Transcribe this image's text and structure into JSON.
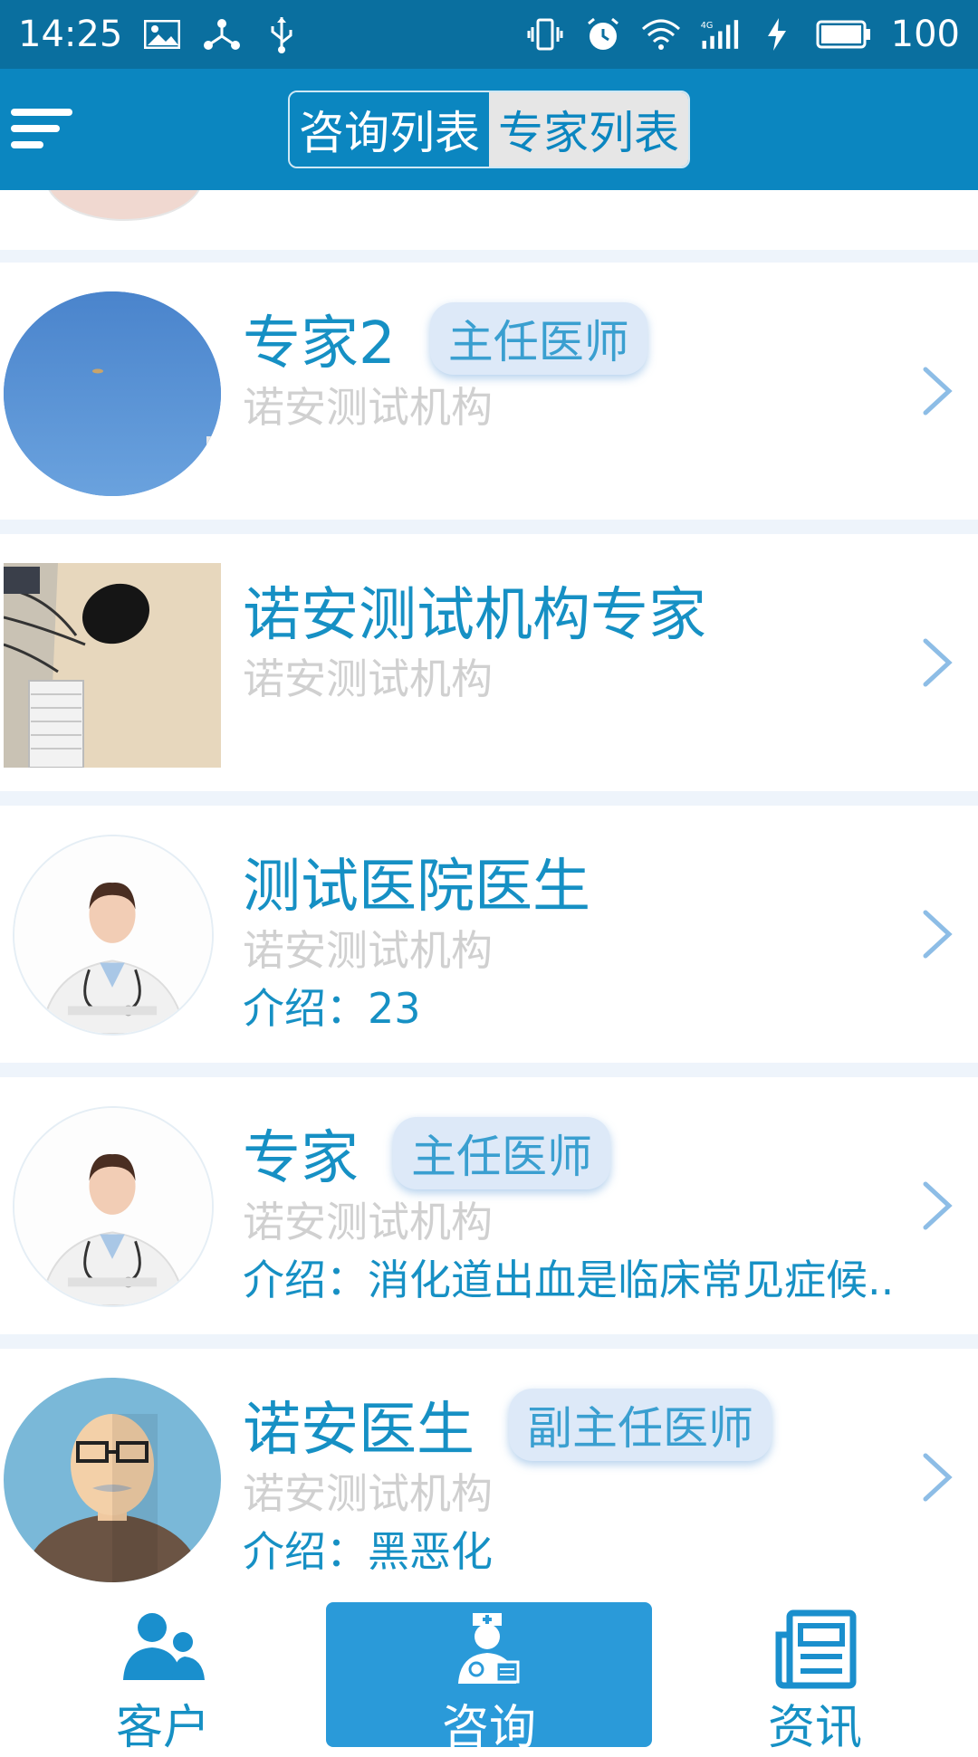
{
  "status_bar": {
    "time": "14:25",
    "battery": "100",
    "icons": [
      "image-icon",
      "share-icon",
      "usb-icon",
      "vibrate-icon",
      "alarm-icon",
      "wifi-icon",
      "signal-4g-icon",
      "charging-icon",
      "battery-icon"
    ]
  },
  "header": {
    "menu_icon": "menu-icon",
    "tabs": [
      {
        "label": "咨询列表",
        "active": true
      },
      {
        "label": "专家列表",
        "active": false
      }
    ]
  },
  "experts": [
    {
      "name": "专家2",
      "title": "主任医师",
      "org": "诺安测试机构",
      "intro": "",
      "avatar": "sky-photo"
    },
    {
      "name": "诺安测试机构专家",
      "title": "",
      "org": "诺安测试机构",
      "intro": "",
      "avatar": "desk-photo"
    },
    {
      "name": "测试医院医生",
      "title": "",
      "org": "诺安测试机构",
      "intro": "介绍：23",
      "avatar": "female-doctor"
    },
    {
      "name": "专家",
      "title": "主任医师",
      "org": "诺安测试机构",
      "intro": "介绍：消化道出血是临床常见症候..",
      "avatar": "female-doctor"
    },
    {
      "name": "诺安医生",
      "title": "副主任医师",
      "org": "诺安测试机构",
      "intro": "介绍：黑恶化",
      "avatar": "bald-man"
    }
  ],
  "bottom_nav": {
    "tabs": [
      {
        "label": "客户",
        "icon": "customers-icon",
        "active": false
      },
      {
        "label": "咨询",
        "icon": "doctor-icon",
        "active": true
      },
      {
        "label": "资讯",
        "icon": "news-icon",
        "active": false
      }
    ]
  },
  "colors": {
    "status_bar": "#0a6f9f",
    "header": "#0b86c0",
    "accent": "#1690c4",
    "muted": "#d0d0d0",
    "badge_bg": "#dde9f8",
    "nav_active": "#2a9ad9"
  }
}
